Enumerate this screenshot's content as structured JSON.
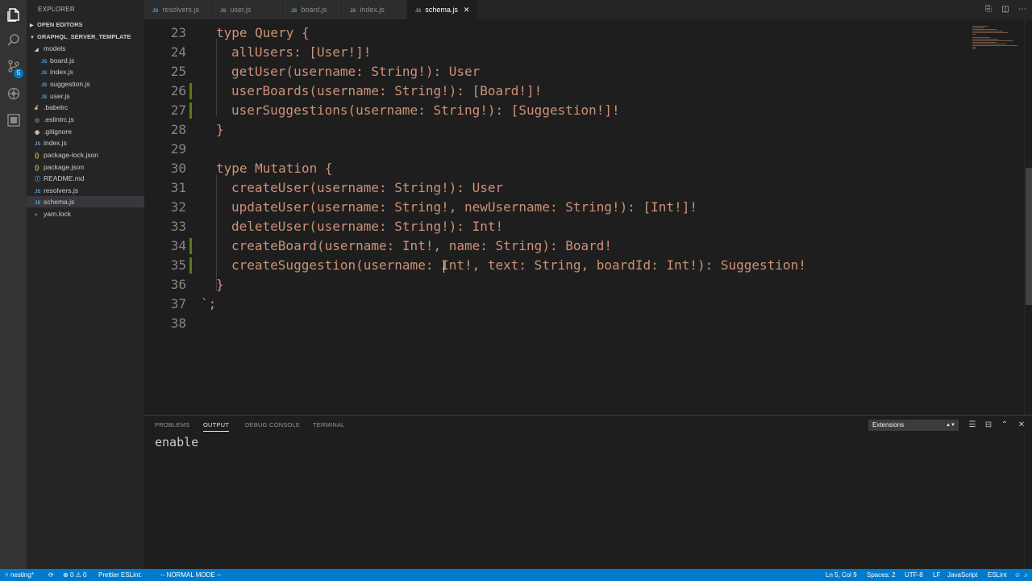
{
  "sidebar": {
    "title": "EXPLORER",
    "open_editors": "OPEN EDITORS",
    "project": "GRAPHQL_SERVER_TEMPLATE",
    "items": [
      {
        "label": "models",
        "icon": "folder-open",
        "indent": 1
      },
      {
        "label": "board.js",
        "icon": "js",
        "indent": 2
      },
      {
        "label": "index.js",
        "icon": "js",
        "indent": 2
      },
      {
        "label": "suggestion.js",
        "icon": "js",
        "indent": 2
      },
      {
        "label": "user.js",
        "icon": "js",
        "indent": 2
      },
      {
        "label": ".babelrc",
        "icon": "babel",
        "indent": 1
      },
      {
        "label": ".eslintrc.js",
        "icon": "eslint",
        "indent": 1
      },
      {
        "label": ".gitignore",
        "icon": "git",
        "indent": 1
      },
      {
        "label": "index.js",
        "icon": "js",
        "indent": 1
      },
      {
        "label": "package-lock.json",
        "icon": "json",
        "indent": 1
      },
      {
        "label": "package.json",
        "icon": "json",
        "indent": 1
      },
      {
        "label": "README.md",
        "icon": "md",
        "indent": 1
      },
      {
        "label": "resolvers.js",
        "icon": "js",
        "indent": 1
      },
      {
        "label": "schema.js",
        "icon": "js",
        "indent": 1,
        "active": true
      },
      {
        "label": "yarn.lock",
        "icon": "yarn",
        "indent": 1
      }
    ]
  },
  "activity_badge": "5",
  "tabs": [
    {
      "label": "resolvers.js",
      "active": false
    },
    {
      "label": "user.js",
      "active": false
    },
    {
      "label": "board.js",
      "active": false
    },
    {
      "label": "index.js",
      "active": false
    },
    {
      "label": "schema.js",
      "active": true
    }
  ],
  "code_lines": [
    {
      "n": "23",
      "text": "type Query {",
      "indent": 1,
      "mod": false
    },
    {
      "n": "24",
      "text": "allUsers: [User!]!",
      "indent": 2,
      "mod": false
    },
    {
      "n": "25",
      "text": "getUser(username: String!): User",
      "indent": 2,
      "mod": false
    },
    {
      "n": "26",
      "text": "userBoards(username: String!): [Board!]!",
      "indent": 2,
      "mod": true
    },
    {
      "n": "27",
      "text": "userSuggestions(username: String!): [Suggestion!]!",
      "indent": 2,
      "mod": true
    },
    {
      "n": "28",
      "text": "}",
      "indent": 1,
      "mod": false
    },
    {
      "n": "29",
      "text": "",
      "indent": 0,
      "mod": false
    },
    {
      "n": "30",
      "text": "type Mutation {",
      "indent": 1,
      "mod": false
    },
    {
      "n": "31",
      "text": "createUser(username: String!): User",
      "indent": 2,
      "mod": false
    },
    {
      "n": "32",
      "text": "updateUser(username: String!, newUsername: String!): [Int!]!",
      "indent": 2,
      "mod": false
    },
    {
      "n": "33",
      "text": "deleteUser(username: String!): Int!",
      "indent": 2,
      "mod": false
    },
    {
      "n": "34",
      "text": "createBoard(username: Int!, name: String): Board!",
      "indent": 2,
      "mod": true
    },
    {
      "n": "35",
      "text": "createSuggestion(username: Int!, text: String, boardId: Int!): Suggestion!",
      "indent": 2,
      "mod": true
    },
    {
      "n": "36",
      "text": "}",
      "indent": 1,
      "mod": false
    },
    {
      "n": "37",
      "text": "`;",
      "indent": 0,
      "mod": false
    },
    {
      "n": "38",
      "text": "",
      "indent": 0,
      "mod": false
    }
  ],
  "panel": {
    "tabs": [
      "PROBLEMS",
      "OUTPUT",
      "DEBUG CONSOLE",
      "TERMINAL"
    ],
    "active_tab": "OUTPUT",
    "channel": "Extensions",
    "output": "enable"
  },
  "status": {
    "branch": "nesting*",
    "errors": "0",
    "warnings": "0",
    "formatters": "Prettier ESLint:",
    "mode": "-- NORMAL MODE --",
    "position": "Ln 5, Col 9",
    "spaces": "Spaces: 2",
    "encoding": "UTF-8",
    "eol": "LF",
    "language": "JavaScript",
    "linter": "ESLint"
  },
  "colors": {
    "accent": "#007acc",
    "code_string": "#ce9178",
    "modified_gutter": "#587c0c"
  }
}
